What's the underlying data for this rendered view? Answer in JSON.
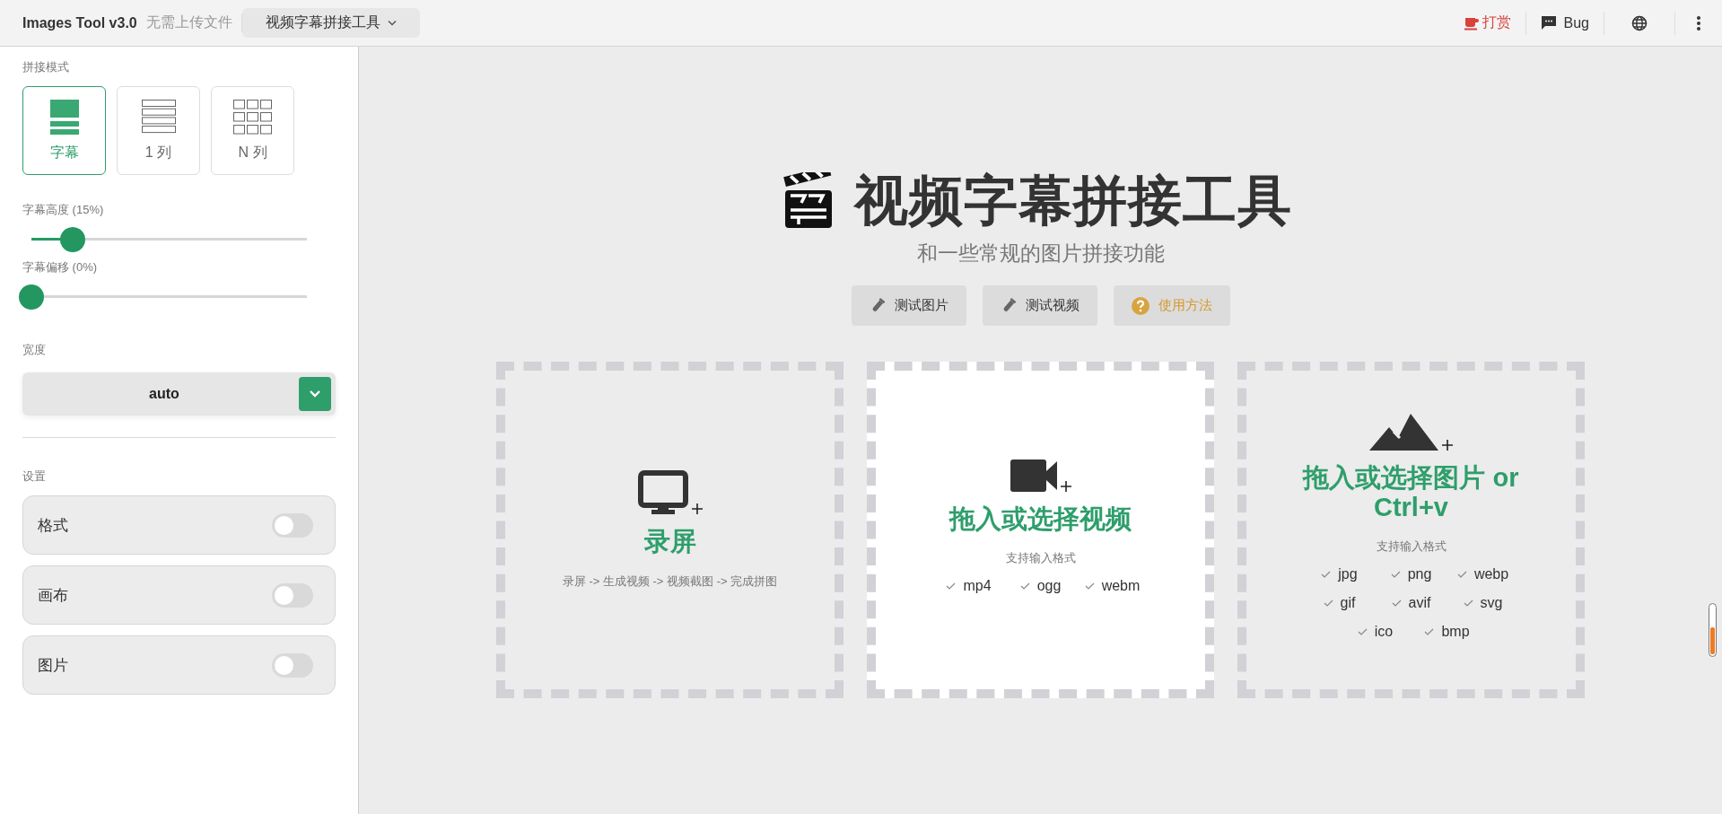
{
  "header": {
    "app_name": "Images Tool v3.0",
    "tagline": "无需上传文件",
    "tool_menu": "视频字幕拼接工具",
    "actions": [
      {
        "kind": "donate",
        "label": "打赏"
      },
      {
        "kind": "bug",
        "label": "Bug"
      },
      {
        "kind": "language"
      },
      {
        "kind": "more"
      }
    ]
  },
  "sidebar": {
    "mode_label": "拼接模式",
    "modes": [
      {
        "kind": "subtitle",
        "label": "字幕",
        "selected": true
      },
      {
        "kind": "single_column",
        "label": "1 列",
        "selected": false
      },
      {
        "kind": "n_columns",
        "label": "N 列",
        "selected": false
      }
    ],
    "sliders": [
      {
        "label": "字幕高度 (15%)",
        "level": 0.15
      },
      {
        "label": "字幕偏移 (0%)",
        "level": 0
      }
    ],
    "width": {
      "label": "宽度",
      "value": "auto"
    },
    "settings": {
      "label": "设置",
      "items": [
        {
          "label": "格式",
          "on": false
        },
        {
          "label": "画布",
          "on": false
        },
        {
          "label": "图片",
          "on": false
        }
      ]
    }
  },
  "main": {
    "title": "视频字幕拼接工具",
    "subtitle": "和一些常规的图片拼接功能",
    "buttons": [
      {
        "kind": "test",
        "label": "测试图片"
      },
      {
        "kind": "test",
        "label": "测试视频"
      },
      {
        "kind": "help",
        "label": "使用方法"
      }
    ],
    "cards": [
      {
        "kind": "screen",
        "title": "录屏",
        "description": "录屏 -> 生成视频 -> 视频截图 -> 完成拼图",
        "highlighted": false
      },
      {
        "kind": "video",
        "title": "拖入或选择视频",
        "formats_label": "支持输入格式",
        "formats": [
          "mp4",
          "ogg",
          "webm"
        ],
        "highlighted": true
      },
      {
        "kind": "image",
        "title": "拖入或选择图片 or Ctrl+v",
        "formats_label": "支持输入格式",
        "formats": [
          "jpg",
          "png",
          "webp",
          "gif",
          "avif",
          "svg",
          "ico",
          "bmp"
        ],
        "highlighted": false
      }
    ]
  }
}
